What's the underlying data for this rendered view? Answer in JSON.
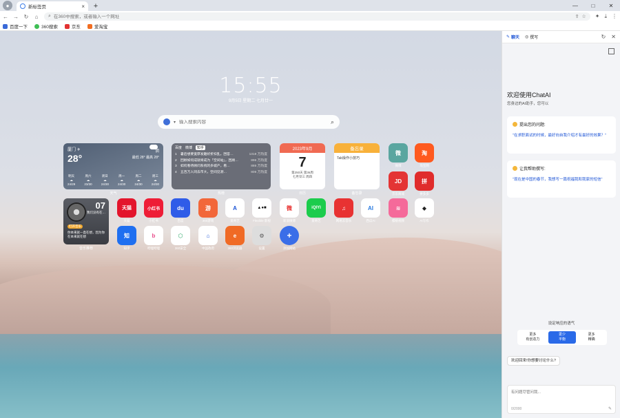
{
  "window": {
    "tab_title": "新标签页",
    "tab_close": "×",
    "new_tab": "+",
    "minimize": "—",
    "maximize": "□",
    "close": "✕"
  },
  "toolbar": {
    "back": "←",
    "forward": "→",
    "reload": "↻",
    "home": "⌂",
    "address_placeholder": "在360中搜索，或者输入一个网址",
    "share": "⇪",
    "star": "☆",
    "extensions": "✦",
    "download": "⤓",
    "menu": "⋮"
  },
  "bookmarks": [
    {
      "label": "百度一下",
      "color": "#3a6ad8"
    },
    {
      "label": "360搜索",
      "color": "#3fbf55"
    },
    {
      "label": "京东",
      "color": "#e23232"
    },
    {
      "label": "爱淘宝",
      "color": "#f26d21"
    }
  ],
  "ntp": {
    "time": "15:55",
    "date": "9月5日 星期二 七月廿一",
    "search_placeholder": "输入搜索内容",
    "search_caret": "▾",
    "search_icon": "⌕"
  },
  "weather": {
    "city": "厦门 ✈",
    "temp": "28°",
    "cond": "阴",
    "range": "最低 28° 最高 28°",
    "label": "天气",
    "forecast": [
      {
        "day": "明天",
        "temp": "24/29"
      },
      {
        "day": "周六",
        "temp": "23/30"
      },
      {
        "day": "周日",
        "temp": "24/30"
      },
      {
        "day": "周一",
        "temp": "24/30"
      },
      {
        "day": "周二",
        "temp": "24/30"
      },
      {
        "day": "周三",
        "temp": "24/30"
      }
    ]
  },
  "hot": {
    "tabs": [
      "百度",
      "微博",
      "知乎"
    ],
    "label": "热榜",
    "rows": [
      {
        "n": "1",
        "t": "暑后想要宽厚发趣好折扣乱，回答…",
        "c": "1318 万热度"
      },
      {
        "n": "2",
        "t": "回顾如何成就将成为「空间站」，回顾…",
        "c": "896 万热度"
      },
      {
        "n": "3",
        "t": "如何看待顾问系统的多城产，看…",
        "c": "886 万热度"
      },
      {
        "n": "4",
        "t": "五百万人同去市大，空间见测…",
        "c": "806 万热度"
      }
    ]
  },
  "calendar": {
    "header": "2023年9月",
    "day": "7",
    "line1": "第250天 第36周",
    "line2": "七月廿三 周四",
    "label": "日历"
  },
  "memo": {
    "header": "备忘录",
    "body": "Tab操作小技巧",
    "label": "备忘录"
  },
  "music": {
    "num": "07",
    "song": "我们没有在…",
    "tag": "打开音乐",
    "lyric": "你本来就一直在想，因为你在本来就在想",
    "label": "音乐推荐"
  },
  "apps": [
    {
      "label": "微博",
      "text": "微",
      "color": "#5aa6a0"
    },
    {
      "label": "淘宝网",
      "text": "淘",
      "color": "#ff5a1f"
    },
    {
      "label": "京东商城",
      "text": "JD",
      "color": "#e43434"
    },
    {
      "label": "拼多多",
      "text": "拼",
      "color": "#e02c2c"
    },
    {
      "label": "天猫",
      "text": "天猫",
      "color": "#e3152c"
    },
    {
      "label": "小红书",
      "text": "小红书",
      "color": "#ee1d36"
    },
    {
      "label": "百度",
      "text": "du",
      "color": "#2f5ce8"
    },
    {
      "label": "360游戏",
      "text": "游",
      "color": "#f2673a"
    },
    {
      "label": "爱奇艺",
      "text": "A",
      "color": "#ffffff"
    },
    {
      "label": "Flexible 影视",
      "text": "▲●■",
      "color": "#ffffff"
    },
    {
      "label": "新浪微博",
      "text": "微",
      "color": "#ffffff"
    },
    {
      "label": "爱奇艺",
      "text": "iQIYI",
      "color": "#1ccc4c"
    },
    {
      "label": "网易云音乐",
      "text": "♫",
      "color": "#e83232"
    },
    {
      "label": "西瓜AI",
      "text": "AI",
      "color": "#ffffff"
    },
    {
      "label": "樱桃视频",
      "text": "≋",
      "color": "#f56a9a"
    },
    {
      "label": "AI写作",
      "text": "◆",
      "color": "#ffffff"
    },
    {
      "label": "知乎",
      "text": "知",
      "color": "#1f6ff0"
    },
    {
      "label": "哔哩哔哩",
      "text": "b",
      "color": "#ffffff"
    },
    {
      "label": "360安全",
      "text": "⬡",
      "color": "#ffffff"
    },
    {
      "label": "中国政府",
      "text": "⌂",
      "color": "#ffffff"
    },
    {
      "label": "360浏览器",
      "text": "e",
      "color": "#f06a25"
    },
    {
      "label": "设置",
      "text": "⚙",
      "color": "#dddddd"
    },
    {
      "label": "添加网站",
      "text": "+",
      "color": "#3a6ee8"
    }
  ],
  "chat": {
    "tab_chat": "聊天",
    "tab_write": "撰写",
    "refresh": "↻",
    "close": "✕",
    "welcome": "欢迎使用ChatAI",
    "welcome_sub": "您身边的AI助手，您可以",
    "card1_title": "提出您的问题:",
    "card1_body": "\"在求职面试的时候，最好向自我介绍才有最好的效果？\"",
    "card2_title": "让我帮助撰写:",
    "card2_body": "\"现在是中国的春节，我想写一篇祝福我和我家的短信\"",
    "tone_title": "设定响应的语气",
    "tones": [
      {
        "line1": "更多",
        "line2": "有创造力"
      },
      {
        "line1": "更少",
        "line2": "平衡"
      },
      {
        "line1": "更多",
        "line2": "精确"
      }
    ],
    "suggestion": "欢迎回来!你想要讨论什么?",
    "input_placeholder": "有问题尽管问我...",
    "counter": "0/2000",
    "send_icon": "✎"
  }
}
